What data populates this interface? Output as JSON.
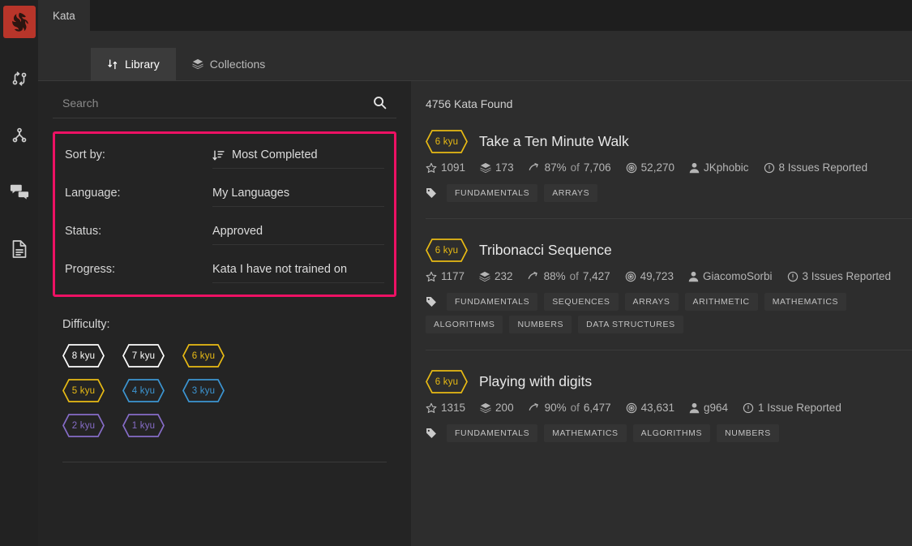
{
  "colors": {
    "highlight": "#ed1164",
    "logo_bg": "#b8352a",
    "kyu_white": "#ffffff",
    "kyu_yellow": "#e8ba14",
    "kyu_blue": "#3c95d2",
    "kyu_purple": "#866cc7"
  },
  "rail": {
    "logo_name": "codewars-logo",
    "items": [
      {
        "icon": "git-compare-icon"
      },
      {
        "icon": "git-fork-icon"
      },
      {
        "icon": "chat-bubbles-icon"
      },
      {
        "icon": "document-icon"
      }
    ]
  },
  "topbar": {
    "browser_tab_label": "Kata"
  },
  "tabs": [
    {
      "label": "Library",
      "icon": "shuffle-icon",
      "active": true
    },
    {
      "label": "Collections",
      "icon": "layers-icon",
      "active": false
    }
  ],
  "search": {
    "value": "",
    "placeholder": "Search",
    "icon": "search-icon"
  },
  "filters": [
    {
      "label": "Sort by:",
      "value": "Most Completed",
      "icon": "sort-descending-icon"
    },
    {
      "label": "Language:",
      "value": "My Languages",
      "icon": ""
    },
    {
      "label": "Status:",
      "value": "Approved",
      "icon": ""
    },
    {
      "label": "Progress:",
      "value": "Kata I have not trained on",
      "icon": ""
    }
  ],
  "difficulty": {
    "title": "Difficulty:",
    "badges": [
      {
        "label": "8 kyu",
        "color": "#ffffff"
      },
      {
        "label": "7 kyu",
        "color": "#ffffff"
      },
      {
        "label": "6 kyu",
        "color": "#e8ba14"
      },
      {
        "label": "5 kyu",
        "color": "#e8ba14"
      },
      {
        "label": "4 kyu",
        "color": "#3c95d2"
      },
      {
        "label": "3 kyu",
        "color": "#3c95d2"
      },
      {
        "label": "2 kyu",
        "color": "#866cc7"
      },
      {
        "label": "1 kyu",
        "color": "#866cc7"
      }
    ]
  },
  "results": {
    "found_label": "4756 Kata Found",
    "kata": [
      {
        "rank": "6 kyu",
        "rank_color": "#e8ba14",
        "title": "Take a Ten Minute Walk",
        "stars": "1091",
        "collections": "173",
        "satisfaction": "87%",
        "satisfaction_of": "of",
        "satisfaction_total": "7,706",
        "completed": "52,270",
        "author": "JKphobic",
        "issues": "8 Issues Reported",
        "tags": [
          "FUNDAMENTALS",
          "ARRAYS"
        ]
      },
      {
        "rank": "6 kyu",
        "rank_color": "#e8ba14",
        "title": "Tribonacci Sequence",
        "stars": "1177",
        "collections": "232",
        "satisfaction": "88%",
        "satisfaction_of": "of",
        "satisfaction_total": "7,427",
        "completed": "49,723",
        "author": "GiacomoSorbi",
        "issues": "3 Issues Reported",
        "tags": [
          "FUNDAMENTALS",
          "SEQUENCES",
          "ARRAYS",
          "ARITHMETIC",
          "MATHEMATICS",
          "ALGORITHMS",
          "NUMBERS",
          "DATA STRUCTURES"
        ]
      },
      {
        "rank": "6 kyu",
        "rank_color": "#e8ba14",
        "title": "Playing with digits",
        "stars": "1315",
        "collections": "200",
        "satisfaction": "90%",
        "satisfaction_of": "of",
        "satisfaction_total": "6,477",
        "completed": "43,631",
        "author": "g964",
        "issues": "1 Issue Reported",
        "tags": [
          "FUNDAMENTALS",
          "MATHEMATICS",
          "ALGORITHMS",
          "NUMBERS"
        ]
      }
    ]
  }
}
